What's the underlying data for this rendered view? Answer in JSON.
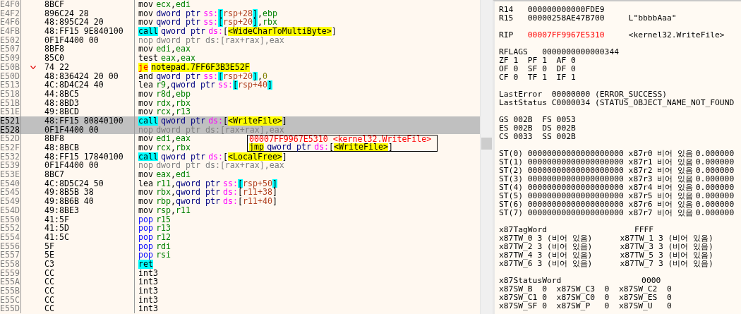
{
  "disassembly": {
    "rows": [
      {
        "address": "E4F0",
        "bytes": "8BCF",
        "mnemonic": "mov",
        "kind": "op",
        "selected": false,
        "jump": false,
        "operands": [
          {
            "text": "ecx",
            "kind": "reg"
          },
          {
            "text": ",",
            "kind": "punct"
          },
          {
            "text": "edi",
            "kind": "reg"
          }
        ]
      },
      {
        "address": "E4F2",
        "bytes": "896C24 28",
        "mnemonic": "mov",
        "kind": "op",
        "selected": false,
        "jump": false,
        "operands": [
          {
            "text": "dword ptr",
            "kind": "size"
          },
          {
            "text": "ss:",
            "kind": "seg"
          },
          {
            "text": "[",
            "kind": "stack"
          },
          {
            "text": "rsp+28",
            "kind": "mem"
          },
          {
            "text": "]",
            "kind": "stack"
          },
          {
            "text": ",",
            "kind": "punct"
          },
          {
            "text": "ebp",
            "kind": "reg"
          }
        ]
      },
      {
        "address": "E4F6",
        "bytes": "48:895C24 20",
        "mnemonic": "mov",
        "kind": "op",
        "selected": false,
        "jump": false,
        "operands": [
          {
            "text": "qword ptr",
            "kind": "size"
          },
          {
            "text": "ss:",
            "kind": "seg"
          },
          {
            "text": "[",
            "kind": "stack"
          },
          {
            "text": "rsp+20",
            "kind": "mem"
          },
          {
            "text": "]",
            "kind": "stack"
          },
          {
            "text": ",",
            "kind": "punct"
          },
          {
            "text": "rbx",
            "kind": "reg"
          }
        ]
      },
      {
        "address": "E4FB",
        "bytes": "48:FF15 9E840100",
        "mnemonic": "call",
        "kind": "call",
        "selected": false,
        "jump": false,
        "operands": [
          {
            "text": "qword ptr",
            "kind": "size"
          },
          {
            "text": "ds:",
            "kind": "seg"
          },
          {
            "text": "[",
            "kind": "punct"
          },
          {
            "text": "<WideCharToMultiByte>",
            "kind": "label"
          },
          {
            "text": "]",
            "kind": "punct"
          }
        ]
      },
      {
        "address": "E502",
        "bytes": "0F1F4400 00",
        "mnemonic": "nop",
        "kind": "faded",
        "selected": false,
        "jump": false,
        "operands": [
          {
            "text": "dword ptr ds:[rax+rax],eax",
            "kind": "faded"
          }
        ]
      },
      {
        "address": "E507",
        "bytes": "8BF8",
        "mnemonic": "mov",
        "kind": "op",
        "selected": false,
        "jump": false,
        "operands": [
          {
            "text": "edi",
            "kind": "reg"
          },
          {
            "text": ",",
            "kind": "punct"
          },
          {
            "text": "eax",
            "kind": "reg"
          }
        ]
      },
      {
        "address": "E509",
        "bytes": "85C0",
        "mnemonic": "test",
        "kind": "op",
        "selected": false,
        "jump": false,
        "operands": [
          {
            "text": "eax",
            "kind": "reg"
          },
          {
            "text": ",",
            "kind": "punct"
          },
          {
            "text": "eax",
            "kind": "reg"
          }
        ]
      },
      {
        "address": "E50B",
        "bytes": "74 22",
        "mnemonic": "je",
        "kind": "branch",
        "selected": false,
        "jump": true,
        "operands": [
          {
            "text": "notepad.7FF6F3B3E52F",
            "kind": "label"
          }
        ]
      },
      {
        "address": "E50D",
        "bytes": "48:836424 20 00",
        "mnemonic": "and",
        "kind": "op",
        "selected": false,
        "jump": false,
        "operands": [
          {
            "text": "qword ptr",
            "kind": "size"
          },
          {
            "text": "ss:",
            "kind": "seg"
          },
          {
            "text": "[",
            "kind": "stack"
          },
          {
            "text": "rsp+20",
            "kind": "mem"
          },
          {
            "text": "]",
            "kind": "stack"
          },
          {
            "text": ",",
            "kind": "punct"
          },
          {
            "text": "0",
            "kind": "num"
          }
        ]
      },
      {
        "address": "E513",
        "bytes": "4C:8D4C24 40",
        "mnemonic": "lea",
        "kind": "op",
        "selected": false,
        "jump": false,
        "operands": [
          {
            "text": "r9",
            "kind": "reg"
          },
          {
            "text": ",",
            "kind": "punct"
          },
          {
            "text": "qword ptr",
            "kind": "size"
          },
          {
            "text": "ss:",
            "kind": "seg"
          },
          {
            "text": "[",
            "kind": "stack"
          },
          {
            "text": "rsp+40",
            "kind": "mem"
          },
          {
            "text": "]",
            "kind": "stack"
          }
        ]
      },
      {
        "address": "E518",
        "bytes": "44:8BC5",
        "mnemonic": "mov",
        "kind": "op",
        "selected": false,
        "jump": false,
        "operands": [
          {
            "text": "r8d",
            "kind": "reg"
          },
          {
            "text": ",",
            "kind": "punct"
          },
          {
            "text": "ebp",
            "kind": "reg"
          }
        ]
      },
      {
        "address": "E51B",
        "bytes": "48:8BD3",
        "mnemonic": "mov",
        "kind": "op",
        "selected": false,
        "jump": false,
        "operands": [
          {
            "text": "rdx",
            "kind": "reg"
          },
          {
            "text": ",",
            "kind": "punct"
          },
          {
            "text": "rbx",
            "kind": "reg"
          }
        ]
      },
      {
        "address": "E51E",
        "bytes": "49:8BCD",
        "mnemonic": "mov",
        "kind": "op",
        "selected": false,
        "jump": false,
        "operands": [
          {
            "text": "rcx",
            "kind": "reg"
          },
          {
            "text": ",",
            "kind": "punct"
          },
          {
            "text": "r13",
            "kind": "reg"
          }
        ]
      },
      {
        "address": "E521",
        "bytes": "48:FF15 80840100",
        "mnemonic": "call",
        "kind": "call",
        "selected": true,
        "jump": false,
        "operands": [
          {
            "text": "qword ptr",
            "kind": "size"
          },
          {
            "text": "ds:",
            "kind": "seg"
          },
          {
            "text": "[",
            "kind": "punct"
          },
          {
            "text": "<WriteFile>",
            "kind": "label"
          },
          {
            "text": "]",
            "kind": "punct"
          }
        ]
      },
      {
        "address": "E528",
        "bytes": "0F1F4400 00",
        "mnemonic": "nop",
        "kind": "faded",
        "selected": true,
        "jump": false,
        "operands": [
          {
            "text": "dword ptr ds:[rax+rax],eax",
            "kind": "faded"
          }
        ]
      },
      {
        "address": "E52D",
        "bytes": "8BF8",
        "mnemonic": "mov",
        "kind": "op",
        "selected": false,
        "jump": false,
        "operands": [
          {
            "text": "edi",
            "kind": "reg"
          },
          {
            "text": ",",
            "kind": "punct"
          },
          {
            "text": "eax",
            "kind": "reg"
          }
        ]
      },
      {
        "address": "E52F",
        "bytes": "48:8BCB",
        "mnemonic": "mov",
        "kind": "op",
        "selected": false,
        "jump": false,
        "operands": [
          {
            "text": "rcx",
            "kind": "reg"
          },
          {
            "text": ",",
            "kind": "punct"
          },
          {
            "text": "rbx",
            "kind": "reg"
          }
        ]
      },
      {
        "address": "E532",
        "bytes": "48:FF15 17840100",
        "mnemonic": "call",
        "kind": "call",
        "selected": false,
        "jump": false,
        "operands": [
          {
            "text": "qword ptr",
            "kind": "size"
          },
          {
            "text": "ds:",
            "kind": "seg"
          },
          {
            "text": "[",
            "kind": "punct"
          },
          {
            "text": "<LocalFree>",
            "kind": "label"
          },
          {
            "text": "]",
            "kind": "punct"
          }
        ]
      },
      {
        "address": "E539",
        "bytes": "0F1F4400 00",
        "mnemonic": "nop",
        "kind": "faded",
        "selected": false,
        "jump": false,
        "operands": [
          {
            "text": "dword ptr ds:[rax+rax],eax",
            "kind": "faded"
          }
        ]
      },
      {
        "address": "E53E",
        "bytes": "8BC7",
        "mnemonic": "mov",
        "kind": "op",
        "selected": false,
        "jump": false,
        "operands": [
          {
            "text": "eax",
            "kind": "reg"
          },
          {
            "text": ",",
            "kind": "punct"
          },
          {
            "text": "edi",
            "kind": "reg"
          }
        ]
      },
      {
        "address": "E540",
        "bytes": "4C:8D5C24 50",
        "mnemonic": "lea",
        "kind": "op",
        "selected": false,
        "jump": false,
        "operands": [
          {
            "text": "r11",
            "kind": "reg"
          },
          {
            "text": ",",
            "kind": "punct"
          },
          {
            "text": "qword ptr",
            "kind": "size"
          },
          {
            "text": "ss:",
            "kind": "seg"
          },
          {
            "text": "[",
            "kind": "stack"
          },
          {
            "text": "rsp+50",
            "kind": "mem"
          },
          {
            "text": "]",
            "kind": "stack"
          }
        ]
      },
      {
        "address": "E545",
        "bytes": "49:8B5B 38",
        "mnemonic": "mov",
        "kind": "op",
        "selected": false,
        "jump": false,
        "operands": [
          {
            "text": "rbx",
            "kind": "reg"
          },
          {
            "text": ",",
            "kind": "punct"
          },
          {
            "text": "qword ptr",
            "kind": "size"
          },
          {
            "text": "ds:",
            "kind": "seg"
          },
          {
            "text": "[",
            "kind": "punct"
          },
          {
            "text": "r11+38",
            "kind": "mem"
          },
          {
            "text": "]",
            "kind": "punct"
          }
        ]
      },
      {
        "address": "E549",
        "bytes": "49:8B6B 40",
        "mnemonic": "mov",
        "kind": "op",
        "selected": false,
        "jump": false,
        "operands": [
          {
            "text": "rbp",
            "kind": "reg"
          },
          {
            "text": ",",
            "kind": "punct"
          },
          {
            "text": "qword ptr",
            "kind": "size"
          },
          {
            "text": "ds:",
            "kind": "seg"
          },
          {
            "text": "[",
            "kind": "punct"
          },
          {
            "text": "r11+40",
            "kind": "mem"
          },
          {
            "text": "]",
            "kind": "punct"
          }
        ]
      },
      {
        "address": "E54D",
        "bytes": "49:8BE3",
        "mnemonic": "mov",
        "kind": "op",
        "selected": false,
        "jump": false,
        "operands": [
          {
            "text": "rsp",
            "kind": "reg"
          },
          {
            "text": ",",
            "kind": "punct"
          },
          {
            "text": "r11",
            "kind": "reg"
          }
        ]
      },
      {
        "address": "E550",
        "bytes": "41:5F",
        "mnemonic": "pop",
        "kind": "stackop",
        "selected": false,
        "jump": false,
        "operands": [
          {
            "text": "r15",
            "kind": "reg"
          }
        ]
      },
      {
        "address": "E552",
        "bytes": "41:5D",
        "mnemonic": "pop",
        "kind": "stackop",
        "selected": false,
        "jump": false,
        "operands": [
          {
            "text": "r13",
            "kind": "reg"
          }
        ]
      },
      {
        "address": "E554",
        "bytes": "41:5C",
        "mnemonic": "pop",
        "kind": "stackop",
        "selected": false,
        "jump": false,
        "operands": [
          {
            "text": "r12",
            "kind": "reg"
          }
        ]
      },
      {
        "address": "E556",
        "bytes": "5F",
        "mnemonic": "pop",
        "kind": "stackop",
        "selected": false,
        "jump": false,
        "operands": [
          {
            "text": "rdi",
            "kind": "reg"
          }
        ]
      },
      {
        "address": "E557",
        "bytes": "5E",
        "mnemonic": "pop",
        "kind": "stackop",
        "selected": false,
        "jump": false,
        "operands": [
          {
            "text": "rsi",
            "kind": "reg"
          }
        ]
      },
      {
        "address": "E558",
        "bytes": "C3",
        "mnemonic": "ret",
        "kind": "call",
        "selected": false,
        "jump": false,
        "operands": []
      },
      {
        "address": "E559",
        "bytes": "CC",
        "mnemonic": "int3",
        "kind": "op",
        "selected": false,
        "jump": false,
        "operands": []
      },
      {
        "address": "E55A",
        "bytes": "CC",
        "mnemonic": "int3",
        "kind": "op",
        "selected": false,
        "jump": false,
        "operands": []
      },
      {
        "address": "E55B",
        "bytes": "CC",
        "mnemonic": "int3",
        "kind": "op",
        "selected": false,
        "jump": false,
        "operands": []
      },
      {
        "address": "E55C",
        "bytes": "CC",
        "mnemonic": "int3",
        "kind": "op",
        "selected": false,
        "jump": false,
        "operands": []
      },
      {
        "address": "E55D",
        "bytes": "CC",
        "mnemonic": "int3",
        "kind": "op",
        "selected": false,
        "jump": false,
        "operands": []
      }
    ],
    "tooltip": {
      "address": "00007FF9967E5310",
      "symbol": "<kernel32.WriteFile>",
      "mnemonic": "jmp",
      "kind": "jump",
      "operands": [
        {
          "text": "qword ptr",
          "kind": "size"
        },
        {
          "text": "ds:",
          "kind": "seg"
        },
        {
          "text": "[",
          "kind": "punct"
        },
        {
          "text": "<WriteFile>",
          "kind": "label"
        },
        {
          "text": "]",
          "kind": "punct"
        }
      ]
    }
  },
  "registers": {
    "groups": [
      [
        {
          "kind": "reg",
          "changed": false,
          "cells": [
            "R14",
            "000000000000FDE9"
          ]
        },
        {
          "kind": "reg",
          "changed": false,
          "cells": [
            "R15",
            "00000258AE47B700",
            "L\"bbbbAaa\""
          ]
        }
      ],
      [
        {
          "kind": "reg",
          "changed": true,
          "cells": [
            "RIP",
            "00007FF9967E5310",
            "<kernel32.WriteFile>"
          ]
        }
      ],
      [
        {
          "kind": "wide",
          "changed": false,
          "cells": [
            "RFLAGS",
            "0000000000000344"
          ]
        },
        {
          "kind": "flags",
          "changed": false,
          "cells": [
            "ZF 1",
            "PF 1",
            "AF 0"
          ]
        },
        {
          "kind": "flags",
          "changed": false,
          "cells": [
            "OF 0",
            "SF 0",
            "DF 0"
          ]
        },
        {
          "kind": "flags",
          "changed": false,
          "cells": [
            "CF 0",
            "TF 1",
            "IF 1"
          ]
        }
      ],
      [
        {
          "kind": "error",
          "changed": false,
          "cells": [
            "LastError",
            "00000000",
            "(ERROR_SUCCESS)"
          ]
        },
        {
          "kind": "error",
          "changed": false,
          "cells": [
            "LastStatus",
            "C0000034",
            "(STATUS_OBJECT_NAME_NOT_FOUND"
          ]
        }
      ],
      [
        {
          "kind": "segments",
          "changed": false,
          "cells": [
            "GS 002B",
            "FS 0053"
          ]
        },
        {
          "kind": "segments",
          "changed": false,
          "cells": [
            "ES 002B",
            "DS 002B"
          ]
        },
        {
          "kind": "segments",
          "changed": false,
          "cells": [
            "CS 0033",
            "SS 002B"
          ]
        }
      ],
      [
        {
          "kind": "fpu",
          "changed": false,
          "cells": [
            "ST(0)",
            "00000000000000000000",
            "x87r0",
            "비어 있음",
            "0.000000"
          ]
        },
        {
          "kind": "fpu",
          "changed": false,
          "cells": [
            "ST(1)",
            "00000000000000000000",
            "x87r1",
            "비어 있음",
            "0.000000"
          ]
        },
        {
          "kind": "fpu",
          "changed": false,
          "cells": [
            "ST(2)",
            "00000000000000000000",
            "x87r2",
            "비어 있음",
            "0.000000"
          ]
        },
        {
          "kind": "fpu",
          "changed": false,
          "cells": [
            "ST(3)",
            "00000000000000000000",
            "x87r3",
            "비어 있음",
            "0.000000"
          ]
        },
        {
          "kind": "fpu",
          "changed": false,
          "cells": [
            "ST(4)",
            "00000000000000000000",
            "x87r4",
            "비어 있음",
            "0.000000"
          ]
        },
        {
          "kind": "fpu",
          "changed": false,
          "cells": [
            "ST(5)",
            "00000000000000000000",
            "x87r5",
            "비어 있음",
            "0.000000"
          ]
        },
        {
          "kind": "fpu",
          "changed": false,
          "cells": [
            "ST(6)",
            "00000000000000000000",
            "x87r6",
            "비어 있음",
            "0.000000"
          ]
        },
        {
          "kind": "fpu",
          "changed": false,
          "cells": [
            "ST(7)",
            "00000000000000000000",
            "x87r7",
            "비어 있음",
            "0.000000"
          ]
        }
      ],
      [
        {
          "kind": "header",
          "changed": false,
          "cells": [
            "x87TagWord",
            "FFFF"
          ]
        },
        {
          "kind": "header",
          "changed": false,
          "cells": [
            "x87TW_0 3 (비어 있음)",
            "x87TW_1 3 (비어 있음)"
          ]
        },
        {
          "kind": "header",
          "changed": false,
          "cells": [
            "x87TW_2 3 (비어 있음)",
            "x87TW_3 3 (비어 있음)"
          ]
        },
        {
          "kind": "header",
          "changed": false,
          "cells": [
            "x87TW_4 3 (비어 있음)",
            "x87TW_5 3 (비어 있음)"
          ]
        },
        {
          "kind": "header",
          "changed": false,
          "cells": [
            "x87TW_6 3 (비어 있음)",
            "x87TW_7 3 (비어 있음)"
          ]
        }
      ],
      [
        {
          "kind": "header",
          "changed": false,
          "cells": [
            "x87StatusWord",
            "0000"
          ]
        },
        {
          "kind": "status",
          "changed": false,
          "cells": [
            "x87SW_B",
            "0",
            "x87SW_C3",
            "0",
            "x87SW_C2",
            "0"
          ]
        },
        {
          "kind": "status",
          "changed": false,
          "cells": [
            "x87SW_C1",
            "0",
            "x87SW_C0",
            "0",
            "x87SW_ES",
            "0"
          ]
        },
        {
          "kind": "status",
          "changed": false,
          "cells": [
            "x87SW_SF",
            "0",
            "x87SW_P",
            "0",
            "x87SW_U",
            "0"
          ]
        }
      ]
    ]
  }
}
